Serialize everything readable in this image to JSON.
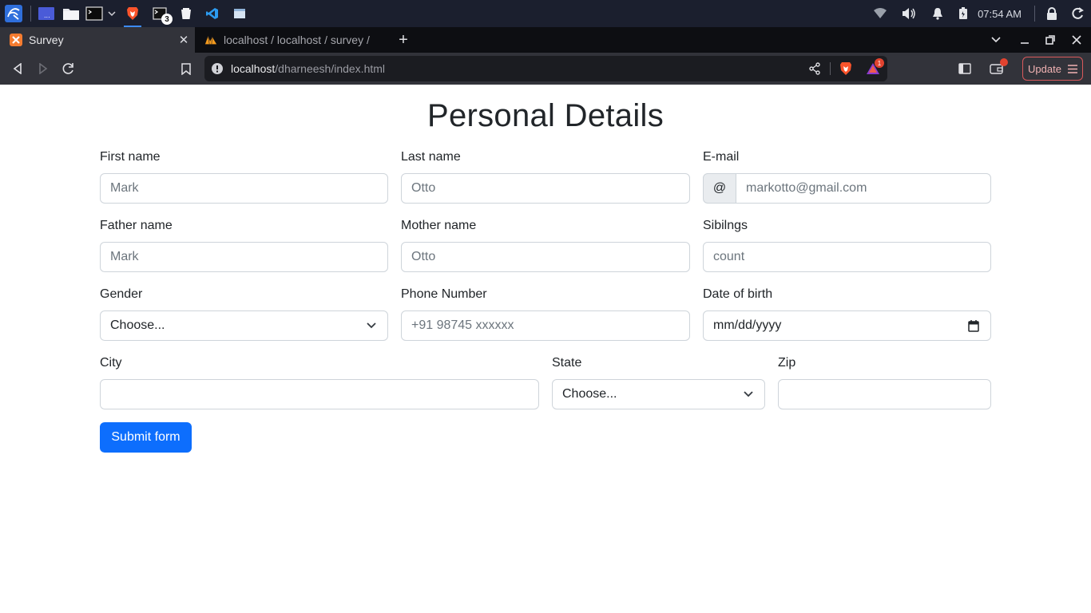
{
  "taskbar": {
    "clock": "07:54 AM",
    "terminal_badge": "3"
  },
  "browser": {
    "tabs": [
      {
        "title": "Survey",
        "active": true
      },
      {
        "title": "localhost / localhost / survey / ",
        "active": false
      }
    ],
    "url_host": "localhost",
    "url_path": "/dharneesh/index.html",
    "notification_count": "1",
    "update_label": "Update"
  },
  "form": {
    "title": "Personal Details",
    "first_name": {
      "label": "First name",
      "placeholder": "Mark"
    },
    "last_name": {
      "label": "Last name",
      "placeholder": "Otto"
    },
    "email": {
      "label": "E-mail",
      "addon": "@",
      "placeholder": "markotto@gmail.com"
    },
    "father_name": {
      "label": "Father name",
      "placeholder": "Mark"
    },
    "mother_name": {
      "label": "Mother name",
      "placeholder": "Otto"
    },
    "siblings": {
      "label": "Sibilngs",
      "placeholder": "count"
    },
    "gender": {
      "label": "Gender",
      "selected": "Choose..."
    },
    "phone": {
      "label": "Phone Number",
      "placeholder": "+91 98745 xxxxxx"
    },
    "dob": {
      "label": "Date of birth",
      "value": "mm/dd/yyyy"
    },
    "city": {
      "label": "City",
      "value": ""
    },
    "state": {
      "label": "State",
      "selected": "Choose..."
    },
    "zip": {
      "label": "Zip",
      "value": ""
    },
    "submit_label": "Submit form"
  },
  "colors": {
    "primary": "#0d6efd",
    "taskbar_bg": "#1b1f2e",
    "tabstrip_bg": "#0d0e12",
    "toolbar_bg": "#32333a"
  }
}
